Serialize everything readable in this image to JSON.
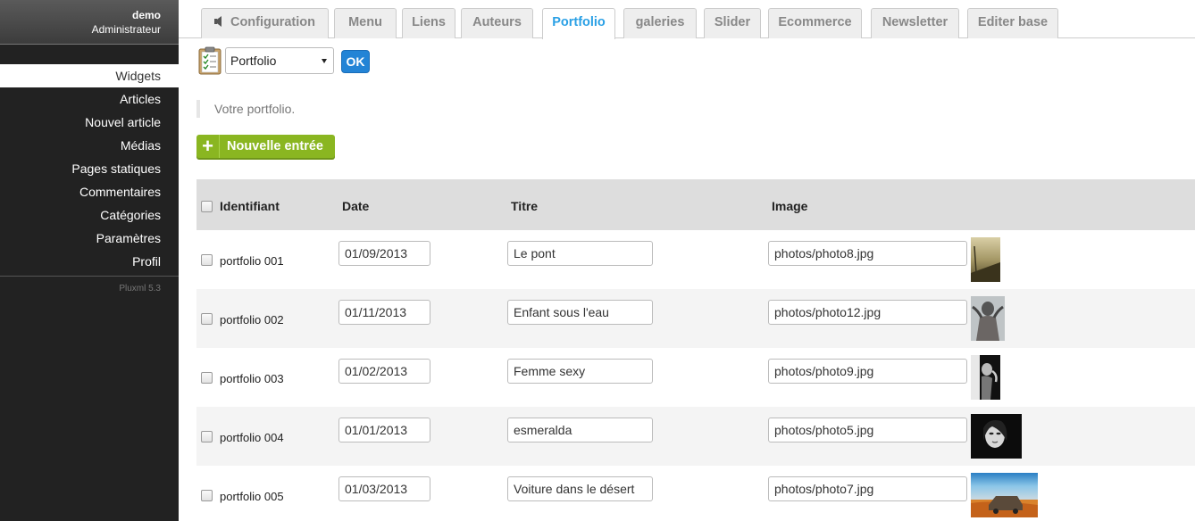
{
  "user": {
    "name": "demo",
    "role": "Administrateur"
  },
  "sidebar": {
    "items": [
      {
        "label": "Widgets",
        "active": true
      },
      {
        "label": "Articles"
      },
      {
        "label": "Nouvel article"
      },
      {
        "label": "Médias"
      },
      {
        "label": "Pages statiques"
      },
      {
        "label": "Commentaires"
      },
      {
        "label": "Catégories"
      },
      {
        "label": "Paramètres"
      },
      {
        "label": "Profil"
      }
    ],
    "version": "Pluxml 5.3"
  },
  "tabs": [
    {
      "label": "Configuration",
      "icon": "speaker-icon"
    },
    {
      "label": "Menu"
    },
    {
      "label": "Liens"
    },
    {
      "label": "Auteurs"
    },
    {
      "label": "Portfolio",
      "active": true
    },
    {
      "label": "galeries"
    },
    {
      "label": "Slider"
    },
    {
      "label": "Ecommerce"
    },
    {
      "label": "Newsletter"
    },
    {
      "label": "Editer base"
    }
  ],
  "toolbar": {
    "select_value": "Portfolio",
    "ok_label": "OK"
  },
  "intro": "Votre portfolio.",
  "new_entry_label": "Nouvelle entrée",
  "table": {
    "headers": {
      "id": "Identifiant",
      "date": "Date",
      "title": "Titre",
      "image": "Image"
    },
    "rows": [
      {
        "id": "portfolio 001",
        "date": "01/09/2013",
        "title": "Le pont",
        "image": "photos/photo8.jpg"
      },
      {
        "id": "portfolio 002",
        "date": "01/11/2013",
        "title": "Enfant sous l'eau",
        "image": "photos/photo12.jpg"
      },
      {
        "id": "portfolio 003",
        "date": "01/02/2013",
        "title": "Femme sexy",
        "image": "photos/photo9.jpg"
      },
      {
        "id": "portfolio 004",
        "date": "01/01/2013",
        "title": "esmeralda",
        "image": "photos/photo5.jpg"
      },
      {
        "id": "portfolio 005",
        "date": "01/03/2013",
        "title": "Voiture dans le désert",
        "image": "photos/photo7.jpg"
      }
    ]
  },
  "colors": {
    "accent": "#2aa0e5",
    "ok": "#2384d6",
    "new": "#8ab621",
    "sidebar": "#222222"
  }
}
